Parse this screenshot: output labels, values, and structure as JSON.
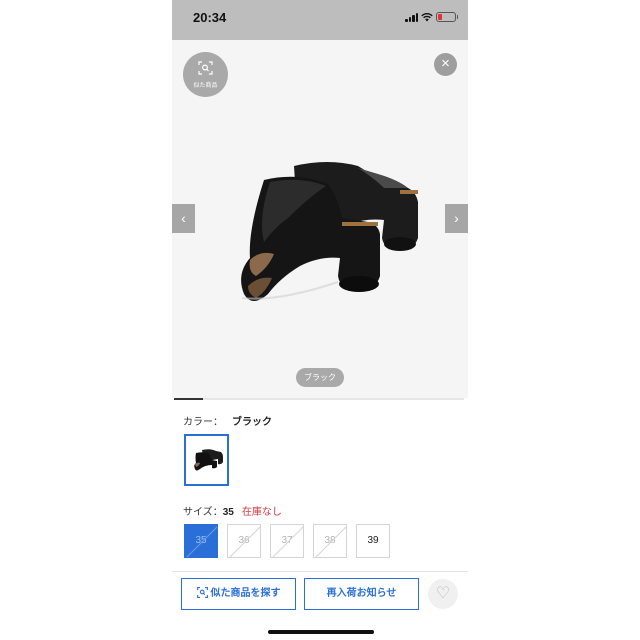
{
  "status_bar": {
    "time": "20:34"
  },
  "gallery": {
    "similar_label": "似た商品",
    "color_chip": "ブラック",
    "progress": 0.1
  },
  "color": {
    "label": "カラー：",
    "value": "ブラック"
  },
  "size": {
    "label": "サイズ：",
    "value": "35",
    "stock_status": "在庫なし",
    "options": [
      {
        "label": "35",
        "state": "selected-unavailable"
      },
      {
        "label": "36",
        "state": "unavailable"
      },
      {
        "label": "37",
        "state": "unavailable"
      },
      {
        "label": "38",
        "state": "unavailable"
      },
      {
        "label": "39",
        "state": "available"
      }
    ]
  },
  "actions": {
    "find_similar": "似た商品を探す",
    "restock_notify": "再入荷お知らせ"
  },
  "icons": {
    "close": "close-icon",
    "prev": "chevron-left-icon",
    "next": "chevron-right-icon",
    "favorite": "heart-icon",
    "similar": "image-search-icon"
  },
  "colors": {
    "accent": "#2a6fd8",
    "out_of_stock": "#d0393e"
  }
}
